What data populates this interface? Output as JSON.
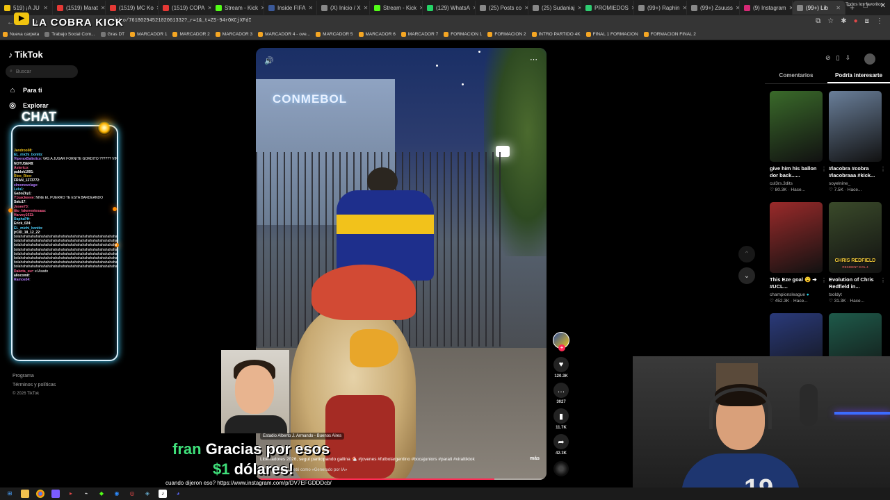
{
  "browser": {
    "tabs": [
      {
        "label": "519) ¡A JU",
        "color": "#f1c40f"
      },
      {
        "label": "(1519) Marat",
        "color": "#e53935"
      },
      {
        "label": "(1519) MC Ko",
        "color": "#e53935"
      },
      {
        "label": "(1519) COPA",
        "color": "#e53935"
      },
      {
        "label": "Stream - Kick",
        "color": "#53fc18"
      },
      {
        "label": "Inside FIFA",
        "color": "#3b5998"
      },
      {
        "label": "(X) Inicio / X",
        "color": "#888888"
      },
      {
        "label": "Stream - Kick",
        "color": "#53fc18"
      },
      {
        "label": "(129) WhatsA",
        "color": "#25d366"
      },
      {
        "label": "(25) Posts co",
        "color": "#888888"
      },
      {
        "label": "(25) Sudaniaj",
        "color": "#888888"
      },
      {
        "label": "PROMIEDOS",
        "color": "#2ecc71"
      },
      {
        "label": "(99+) Raphin",
        "color": "#888888"
      },
      {
        "label": "(99+) Zsuuss",
        "color": "#888888"
      },
      {
        "label": "(9) Instagram",
        "color": "#d62976"
      },
      {
        "label": "(99+) Lib",
        "color": "#888888"
      }
    ],
    "new_tab": "+",
    "url": "video/7618029452102061332?_r=1&_t=ZS-94rOKCjXFdI",
    "window_controls": [
      "–",
      "□",
      "✕"
    ]
  },
  "bookmarks": [
    {
      "label": "Nueva carpeta",
      "icon": "folder"
    },
    {
      "label": "Trabajo Social Com...",
      "icon": "bookmark"
    },
    {
      "label": "Gras DT",
      "icon": "bookmark"
    },
    {
      "label": "MARCADOR 1",
      "icon": "folder"
    },
    {
      "label": "MARCADOR 2",
      "icon": "folder"
    },
    {
      "label": "MARCADOR 3",
      "icon": "folder"
    },
    {
      "label": "MARCADOR 4 - ove...",
      "icon": "folder"
    },
    {
      "label": "MARCADOR 5",
      "icon": "folder"
    },
    {
      "label": "MARCADOR 6",
      "icon": "folder"
    },
    {
      "label": "MARCADOR 7",
      "icon": "folder"
    },
    {
      "label": "FORMACION 1",
      "icon": "folder"
    },
    {
      "label": "FORMACION 2",
      "icon": "folder"
    },
    {
      "label": "INTRO PARTIDO 4K",
      "icon": "folder"
    },
    {
      "label": "FINAL 1 FORMACION",
      "icon": "folder"
    },
    {
      "label": "FORMACION FINAL 2",
      "icon": "folder"
    }
  ],
  "bookmarks_all": "Todos los favoritos",
  "stream_brand": "LA COBRA KICK",
  "tiktok": {
    "logo": "TikTok",
    "search_placeholder": "Buscar",
    "nav": [
      {
        "label": "Para ti",
        "icon": "home-icon"
      },
      {
        "label": "Explorar",
        "icon": "compass-icon"
      }
    ],
    "footer": [
      "Programa",
      "Términos y políticas",
      "© 2026 TikTok"
    ]
  },
  "chat": {
    "title": "CHAT",
    "messages": [
      {
        "user": "Jandroo08",
        "text": "",
        "color": "#f0c419"
      },
      {
        "user": "EL_michi_bonito",
        "text": "",
        "color": "#4ad1ff"
      },
      {
        "user": "ViperaxBalistico",
        "text": "VAS A JUGAR FORNITE GORDITO ?????? VINE DE LA PROMO DE FORNITE EN TIKTOK",
        "color": "#b47cff"
      },
      {
        "user": "NOTUSER8",
        "text": "",
        "color": "#ffffff"
      },
      {
        "user": "Asterico",
        "text": "",
        "color": "#ff5c8a"
      },
      {
        "user": "pablok1991",
        "text": "",
        "color": "#ffffff"
      },
      {
        "user": "Rico_Rico",
        "text": "",
        "color": "#f0c419"
      },
      {
        "user": "FRAN_1273772",
        "text": "",
        "color": "#ffffff"
      },
      {
        "user": "elmonovelage",
        "text": "",
        "color": "#b47cff"
      },
      {
        "user": "Lelu1",
        "text": "",
        "color": "#4ad1ff"
      },
      {
        "user": "GaboZky1",
        "text": "",
        "color": "#ffffff"
      },
      {
        "user": "Y1uackeeee",
        "text": "NINE EL PUERRO TE ESTA BARDEANDO",
        "color": "#ff5c8a"
      },
      {
        "user": "Satu17",
        "text": "",
        "color": "#ffffff"
      },
      {
        "user": "Josee73",
        "text": "",
        "color": "#ff5c8a"
      },
      {
        "user": "tito_fakeventesaaa",
        "text": "",
        "color": "#ff5c8a"
      },
      {
        "user": "Harvey1011",
        "text": "",
        "color": "#ff5c8a"
      },
      {
        "user": "RaphaPH",
        "text": "",
        "color": "#4ad1ff"
      },
      {
        "user": "Erick_024",
        "text": "",
        "color": "#ffffff"
      },
      {
        "user": "EL_michi_bonito",
        "text": "",
        "color": "#4ad1ff"
      },
      {
        "user": "jrCID_18_12_22",
        "text": "",
        "color": "#ffffff"
      },
      {
        "user": "",
        "text": "bolahahahahahahahahahahahahahahahahahahahahahahahahahaha",
        "color": "#ffffff"
      },
      {
        "user": "",
        "text": "bolahahahahahahahahahahahahahahahahahahahahahahahahahaha",
        "color": "#ffffff"
      },
      {
        "user": "",
        "text": "bolahahahahahahahahahahahahahahahahahahahahahahahahahaha",
        "color": "#ffffff"
      },
      {
        "user": "",
        "text": "bolahahahahahahahahahahahahahahahahahahahahahahahahahaha",
        "color": "#ffffff"
      },
      {
        "user": "",
        "text": "bolahahahahahahahahahahahahahahahahahahahahahahahahahaha",
        "color": "#ffffff"
      },
      {
        "user": "",
        "text": "bolahahahahahahahahahahahahahahahahahahahahahahahahahaha",
        "color": "#ffffff"
      },
      {
        "user": "",
        "text": "bolahahahahahahahahahahahahahahahahahahahahahahahahahaha",
        "color": "#ffffff"
      },
      {
        "user": "",
        "text": "bolahahahahahahahahahahahahahahahahahahahahahahahahahaha",
        "color": "#ffffff"
      },
      {
        "user": "Dakota_sur",
        "text": "el Asado",
        "color": "#ff5c8a"
      },
      {
        "user": "allocomit",
        "text": "",
        "color": "#ffffff"
      },
      {
        "user": "Ramos04",
        "text": "",
        "color": "#b47cff"
      }
    ]
  },
  "video": {
    "sign": "CONMEBOL",
    "location": "Estadio Alberto J. Armando - Buenos Aires",
    "caption": "Libertadores 2026, seguí participando gallina 🐔 #jovenes #futbolargentino #bocajuniors #parati #viraltiktok",
    "more": "más",
    "ai_label": "Se etiquetó como «Generado por IA»",
    "progress": 0.82,
    "likes": "120.3K",
    "comments": "3027",
    "saves": "11.7K",
    "shares": "42.3K"
  },
  "right_panel": {
    "tabs": [
      "Comentarios",
      "Podría interesarte"
    ],
    "active_tab": 1,
    "cards": [
      {
        "title": "give him his ballon dor back......",
        "author": "cul3rs.3dits",
        "likes": "80.3K",
        "time": "Hace...",
        "bg": "#3a6a2a",
        "overlay": "",
        "overlay_sub": ""
      },
      {
        "title": "#lacobra #cobra #lacobraaa #kick...",
        "author": "soyelnine_",
        "likes": "7.5K",
        "time": "Hace...",
        "bg": "#6a7f9a",
        "overlay": "",
        "overlay_sub": ""
      },
      {
        "title": "This Eze goal 😮 ➔ #UCL...",
        "author": "championsleague",
        "likes": "452.3K",
        "time": "Hace...",
        "bg": "#9a2a2a",
        "overlay": "",
        "overlay_sub": "",
        "verified": true
      },
      {
        "title": "Evolution of Chris Redfield in...",
        "author": "tsoldyt",
        "likes": "31.3K",
        "time": "Hace...",
        "bg": "#3a4a2a",
        "overlay": "CHRIS REDFIELD",
        "overlay_sub": "RESIDENT EVIL 4"
      },
      {
        "title": "",
        "author": "",
        "likes": "",
        "time": "",
        "bg": "#2a3a7a",
        "overlay": "",
        "overlay_sub": ""
      },
      {
        "title": "",
        "author": "",
        "likes": "",
        "time": "",
        "bg": "#1e5a4a",
        "overlay": "",
        "overlay_sub": ""
      }
    ]
  },
  "overlay": {
    "donor": "fran",
    "message_part1": "Gracias por esos",
    "amount": "$1",
    "message_part2": "dólares!",
    "bottom_message": "cuando dijeron eso? https://www.instagram.com/p/DV7EFGDDDcb/"
  },
  "colors": {
    "tiktok_red": "#fe2c55",
    "donation_green": "#3fe07a",
    "chat_glow": "#4ad1ff"
  }
}
